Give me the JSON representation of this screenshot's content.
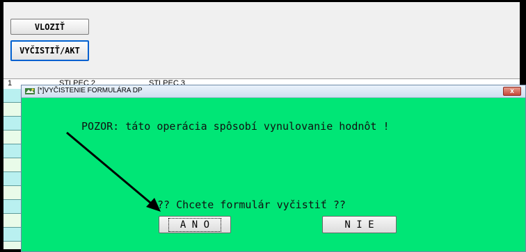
{
  "toolbar": {
    "insert_label": "VLOZIŤ",
    "clear_label": "VYČISTIŤ/AKT"
  },
  "grid": {
    "header": [
      "1",
      "STLPEC 2",
      "STLPEC 3"
    ]
  },
  "dialog": {
    "title": "[*]VYČISTENIE FORMULÁRA DP",
    "close_label": "x",
    "warning": "POZOR: táto operácia spôsobí vynulovanie hodnôt !",
    "question": "?? Chcete formulár vyčistiť ??",
    "yes_label": "A N O",
    "no_label": "N I E"
  },
  "colors": {
    "dialog_background": "#00e676",
    "row_alt_a": "#b9f0f0",
    "row_alt_b": "#e9fbe9",
    "focus_border": "#0060d0"
  }
}
